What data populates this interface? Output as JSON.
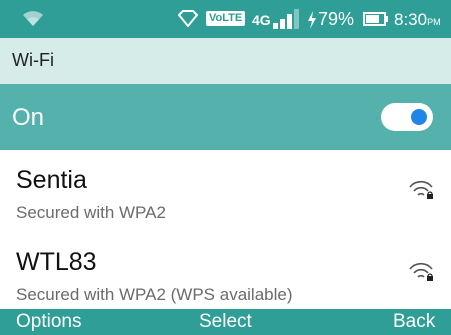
{
  "status_bar": {
    "wifi_icon": "wifi-icon",
    "location_icon": "diamond-icon",
    "volte_label": "VoLTE",
    "network_label": "4G",
    "signal_icon": "cell-signal-icon",
    "charging_icon": "charging-icon",
    "battery_percent": "79%",
    "battery_icon": "battery-icon",
    "time": "8:30",
    "ampm": "PM"
  },
  "header": {
    "title": "Wi-Fi"
  },
  "wifi_toggle": {
    "label": "On",
    "enabled": true,
    "accent_color": "#1f86e8"
  },
  "networks": [
    {
      "ssid": "Sentia",
      "security": "Secured with WPA2",
      "icon": "wifi-locked-icon"
    },
    {
      "ssid": "WTL83",
      "security": "Secured with WPA2 (WPS available)",
      "icon": "wifi-locked-icon"
    }
  ],
  "softkeys": {
    "left": "Options",
    "center": "Select",
    "right": "Back"
  },
  "colors": {
    "status_bar": "#2e9e97",
    "title_bar": "#d6ece9",
    "toggle_row": "#55b1ab",
    "softkey_bar": "#2e9e97"
  }
}
